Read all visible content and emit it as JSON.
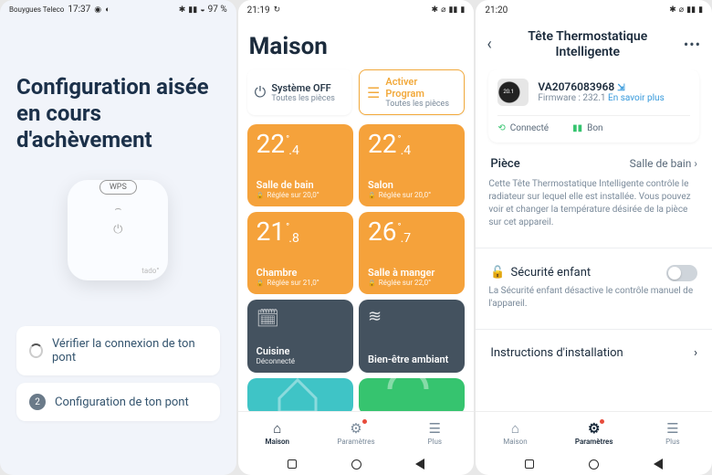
{
  "phone1": {
    "status": {
      "carrier": "Bouygues Teleco",
      "time": "17:37",
      "battery": "97 %"
    },
    "title": "Configuration aisée en cours d'achèvement",
    "device": {
      "wps": "WPS",
      "brand": "tado°"
    },
    "steps": [
      {
        "label": "Vérifier la connexion de ton pont"
      },
      {
        "num": "2",
        "label": "Configuration de ton pont"
      }
    ]
  },
  "phone2": {
    "status": {
      "time": "21:19"
    },
    "title": "Maison",
    "modes": [
      {
        "title": "Système OFF",
        "sub": "Toutes les pièces"
      },
      {
        "title": "Activer Program",
        "sub": "Toutes les pièces"
      }
    ],
    "rooms": [
      {
        "whole": "22",
        "frac": ".4",
        "name": "Salle de bain",
        "sub": "Réglée sur 20,0°"
      },
      {
        "whole": "22",
        "frac": ".4",
        "name": "Salon",
        "sub": "Réglée sur 20,0°"
      },
      {
        "whole": "21",
        "frac": ".8",
        "name": "Chambre",
        "sub": "Réglée sur 21,0°"
      },
      {
        "whole": "26",
        "frac": ".7",
        "name": "Salle à manger",
        "sub": "Réglée sur 22,0°"
      }
    ],
    "other_tiles": [
      {
        "name": "Cuisine",
        "sub": "Déconnecté"
      },
      {
        "name": "Bien-être ambiant",
        "sub": ""
      }
    ],
    "tabs": {
      "home": "Maison",
      "settings": "Paramètres",
      "more": "Plus"
    }
  },
  "phone3": {
    "status": {
      "time": "21:20"
    },
    "title": "Tête Thermostatique Intelligente",
    "trv": {
      "serial": "VA2076083968",
      "fw_label": "Firmware :",
      "fw_ver": "232.1",
      "fw_link": "En savoir plus",
      "status_connected": "Connecté",
      "status_battery": "Bon"
    },
    "room": {
      "label": "Pièce",
      "value": "Salle de bain"
    },
    "desc": "Cette Tête Thermostatique Intelligente contrôle le radiateur sur lequel elle est installée. Vous pouvez voir et changer la température désirée de la pièce sur cet appareil.",
    "child_lock": {
      "label": "Sécurité enfant",
      "desc": "La Sécurité enfant désactive le contrôle manuel de l'appareil."
    },
    "instructions": "Instructions d'installation",
    "tabs": {
      "home": "Maison",
      "settings": "Paramètres",
      "more": "Plus"
    }
  }
}
